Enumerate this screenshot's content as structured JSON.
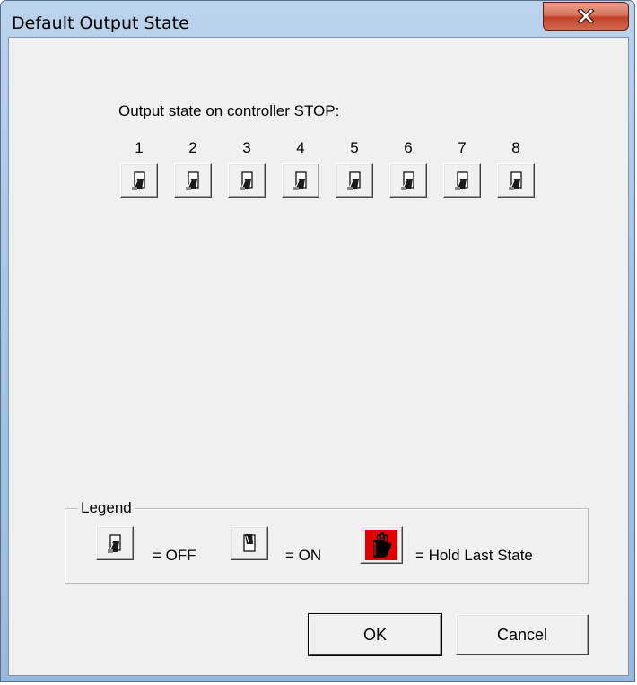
{
  "window": {
    "title": "Default Output State"
  },
  "heading": "Output state on controller STOP:",
  "outputs": [
    {
      "number": "1",
      "state": "off"
    },
    {
      "number": "2",
      "state": "off"
    },
    {
      "number": "3",
      "state": "off"
    },
    {
      "number": "4",
      "state": "off"
    },
    {
      "number": "5",
      "state": "off"
    },
    {
      "number": "6",
      "state": "off"
    },
    {
      "number": "7",
      "state": "off"
    },
    {
      "number": "8",
      "state": "off"
    }
  ],
  "legend": {
    "title": "Legend",
    "off_label": "= OFF",
    "on_label": "= ON",
    "hold_label": "= Hold Last State"
  },
  "buttons": {
    "ok": "OK",
    "cancel": "Cancel"
  },
  "icons": {
    "off": "switch-off-icon",
    "on": "switch-on-icon",
    "hold": "hand-stop-icon",
    "close": "close-icon"
  },
  "colors": {
    "close_button": "#c2412a",
    "hold_icon_bg": "#e00000"
  }
}
